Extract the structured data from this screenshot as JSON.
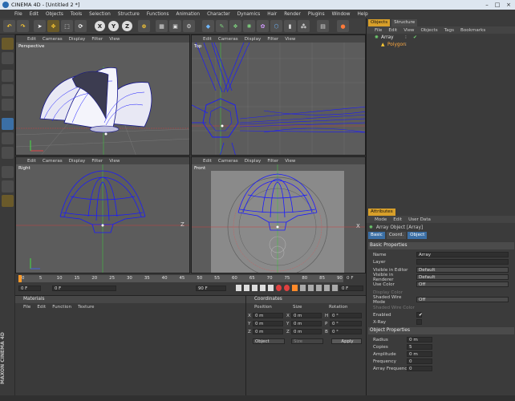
{
  "window": {
    "title": "CINEMA 4D - [Untitled 2 *]"
  },
  "menu": [
    "File",
    "Edit",
    "Objects",
    "Tools",
    "Selection",
    "Structure",
    "Functions",
    "Animation",
    "Character",
    "Dynamics",
    "Hair",
    "Render",
    "Plugins",
    "Window",
    "Help"
  ],
  "toolbar": {
    "axis_x": "X",
    "axis_y": "Y",
    "axis_z": "Z"
  },
  "viewport_menu": [
    "Edit",
    "Cameras",
    "Display",
    "Filter",
    "View"
  ],
  "viewports": {
    "perspective": "Perspective",
    "top": "Top",
    "right": "Right",
    "front": "Front"
  },
  "axes": {
    "x": "X",
    "y": "Y",
    "z": "Z"
  },
  "timeline": {
    "ticks": [
      "0",
      "5",
      "10",
      "15",
      "20",
      "25",
      "30",
      "35",
      "40",
      "45",
      "50",
      "55",
      "60",
      "65",
      "70",
      "75",
      "80",
      "85",
      "90"
    ],
    "end_frame": "0 F",
    "current_frame": "0 F",
    "start_field": "0 F",
    "end_field": "90 F",
    "value_field": "0 F",
    "progress": 0
  },
  "objects_panel": {
    "tabs": [
      "Objects",
      "Structure"
    ],
    "menu": [
      "File",
      "Edit",
      "View",
      "Objects",
      "Tags",
      "Bookmarks"
    ],
    "items": [
      {
        "name": "Array"
      },
      {
        "name": "Polygon"
      }
    ]
  },
  "attributes": {
    "tab": "Attributes",
    "menu": [
      "Mode",
      "Edit",
      "User Data"
    ],
    "object_title": "Array Object [Array]",
    "subtabs": [
      "Basic",
      "Coord.",
      "Object"
    ],
    "basic_header": "Basic Properties",
    "basic": [
      {
        "label": "Name",
        "value": "Array"
      },
      {
        "label": "Layer",
        "value": ""
      },
      {
        "label": "Visible in Editor",
        "value": "Default"
      },
      {
        "label": "Visible in Renderer",
        "value": "Default"
      },
      {
        "label": "Use Color",
        "value": "Off"
      },
      {
        "label": "Display Color",
        "value": ""
      },
      {
        "label": "Shaded Wire Mode",
        "value": "Off"
      },
      {
        "label": "Shaded Wire Color",
        "value": ""
      },
      {
        "label": "Enabled",
        "value": "✔"
      },
      {
        "label": "X-Ray",
        "value": ""
      }
    ],
    "object_header": "Object Properties",
    "object": [
      {
        "label": "Radius",
        "value": "0 m"
      },
      {
        "label": "Copies",
        "value": "5"
      },
      {
        "label": "Amplitude",
        "value": "0 m"
      },
      {
        "label": "Frequency",
        "value": "0"
      },
      {
        "label": "Array Frequency",
        "value": "0"
      }
    ]
  },
  "materials": {
    "title": "Materials",
    "menu": [
      "File",
      "Edit",
      "Function",
      "Texture"
    ]
  },
  "coordinates": {
    "title": "Coordinates",
    "headers": [
      "Position",
      "Size",
      "Rotation"
    ],
    "rows": [
      {
        "axis": "X",
        "pos": "0 m",
        "saxis": "X",
        "size": "0 m",
        "raxis": "H",
        "rot": "0 °"
      },
      {
        "axis": "Y",
        "pos": "0 m",
        "saxis": "Y",
        "size": "0 m",
        "raxis": "P",
        "rot": "0 °"
      },
      {
        "axis": "Z",
        "pos": "0 m",
        "saxis": "Z",
        "size": "0 m",
        "raxis": "B",
        "rot": "0 °"
      }
    ],
    "mode": "Object",
    "size_mode": "Size",
    "apply": "Apply"
  },
  "brand": "MAXON CINEMA 4D",
  "colors": {
    "accent": "#d79f2a",
    "wire": "#1a1aff",
    "selected": "#ffffff",
    "grid": "#7a7a7a"
  }
}
